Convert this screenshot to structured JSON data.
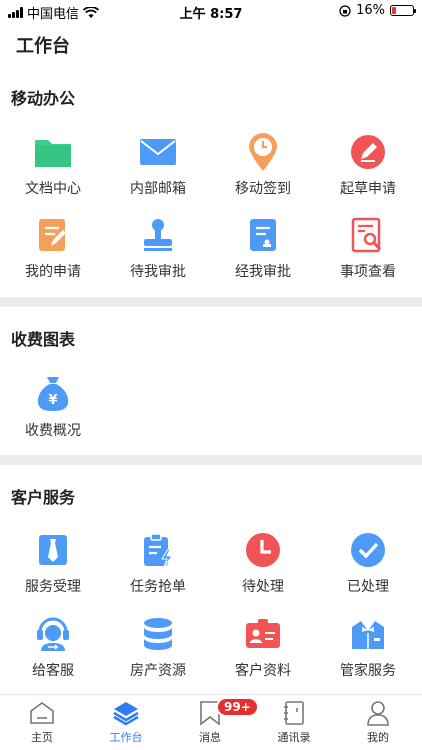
{
  "status_bar": {
    "carrier": "中国电信",
    "time": "上午 8:57",
    "battery": "16%"
  },
  "page": {
    "title": "工作台"
  },
  "sections": [
    {
      "title": "移动办公",
      "items": [
        {
          "label": "文档中心",
          "icon": "folder-icon",
          "color": "#3ecf8e"
        },
        {
          "label": "内部邮箱",
          "icon": "mail-icon",
          "color": "#4d9bf7"
        },
        {
          "label": "移动签到",
          "icon": "location-clock-icon",
          "color": "#f5a05a"
        },
        {
          "label": "起草申请",
          "icon": "pen-circle-icon",
          "color": "#f05454"
        },
        {
          "label": "我的申请",
          "icon": "edit-doc-icon",
          "color": "#f5a05a"
        },
        {
          "label": "待我审批",
          "icon": "stamp-icon",
          "color": "#4d9bf7"
        },
        {
          "label": "经我审批",
          "icon": "approved-doc-icon",
          "color": "#4d9bf7"
        },
        {
          "label": "事项查看",
          "icon": "search-doc-icon",
          "color": "#f05454"
        }
      ]
    },
    {
      "title": "收费图表",
      "items": [
        {
          "label": "收费概况",
          "icon": "money-bag-icon",
          "color": "#4d9bf7"
        }
      ]
    },
    {
      "title": "客户服务",
      "items": [
        {
          "label": "服务受理",
          "icon": "tie-icon",
          "color": "#4d9bf7"
        },
        {
          "label": "任务抢单",
          "icon": "clipboard-bolt-icon",
          "color": "#4d9bf7"
        },
        {
          "label": "待处理",
          "icon": "clock-icon",
          "color": "#f05454"
        },
        {
          "label": "已处理",
          "icon": "check-circle-icon",
          "color": "#4d9bf7"
        },
        {
          "label": "给客服",
          "icon": "headset-icon",
          "color": "#4d9bf7"
        },
        {
          "label": "房产资源",
          "icon": "database-icon",
          "color": "#4d9bf7"
        },
        {
          "label": "客户资料",
          "icon": "id-card-icon",
          "color": "#f05454"
        },
        {
          "label": "管家服务",
          "icon": "butler-icon",
          "color": "#4d9bf7"
        }
      ]
    }
  ],
  "tabbar": {
    "items": [
      {
        "label": "主页",
        "icon": "home-icon"
      },
      {
        "label": "工作台",
        "icon": "layers-icon"
      },
      {
        "label": "消息",
        "icon": "bookmark-icon",
        "badge": "99+"
      },
      {
        "label": "通讯录",
        "icon": "contacts-book-icon"
      },
      {
        "label": "我的",
        "icon": "user-icon"
      }
    ],
    "active_color": "#2f7cf6"
  }
}
